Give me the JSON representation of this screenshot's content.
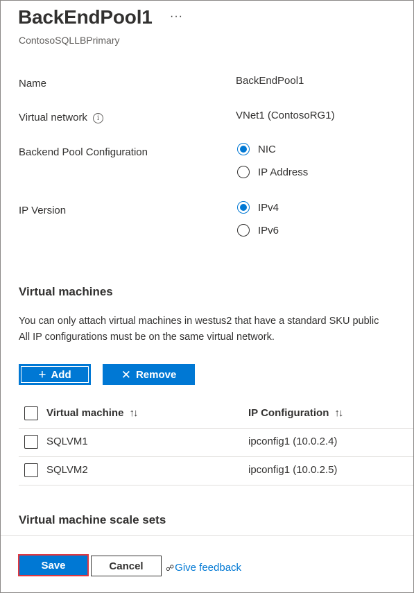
{
  "header": {
    "title": "BackEndPool1",
    "more_label": "···",
    "subtitle": "ContosoSQLLBPrimary"
  },
  "fields": {
    "name_label": "Name",
    "name_value": "BackEndPool1",
    "vnet_label": "Virtual network",
    "vnet_info_icon": "i",
    "vnet_value": "VNet1 (ContosoRG1)",
    "pool_config_label": "Backend Pool Configuration",
    "pool_config_options": [
      {
        "label": "NIC",
        "checked": true
      },
      {
        "label": "IP Address",
        "checked": false
      }
    ],
    "ip_version_label": "IP Version",
    "ip_version_options": [
      {
        "label": "IPv4",
        "checked": true
      },
      {
        "label": "IPv6",
        "checked": false
      }
    ]
  },
  "vms": {
    "heading": "Virtual machines",
    "desc_line1": "You can only attach virtual machines in westus2 that have a standard SKU public",
    "desc_line2": "All IP configurations must be on the same virtual network.",
    "add_icon": "+",
    "add_label": "Add",
    "remove_icon": "✕",
    "remove_label": "Remove",
    "table": {
      "col_vm": "Virtual machine",
      "col_ip": "IP Configuration",
      "sort_icon": "↑↓",
      "rows": [
        {
          "vm": "SQLVM1",
          "ip": "ipconfig1 (10.0.2.4)"
        },
        {
          "vm": "SQLVM2",
          "ip": "ipconfig1 (10.0.2.5)"
        }
      ]
    }
  },
  "scale_sets": {
    "heading": "Virtual machine scale sets"
  },
  "footer": {
    "save_label": "Save",
    "cancel_label": "Cancel",
    "feedback_icon": "☍",
    "feedback_label": "Give feedback"
  },
  "colors": {
    "accent": "#0078d4",
    "save_highlight_border": "#e0373f",
    "text": "#323130"
  }
}
